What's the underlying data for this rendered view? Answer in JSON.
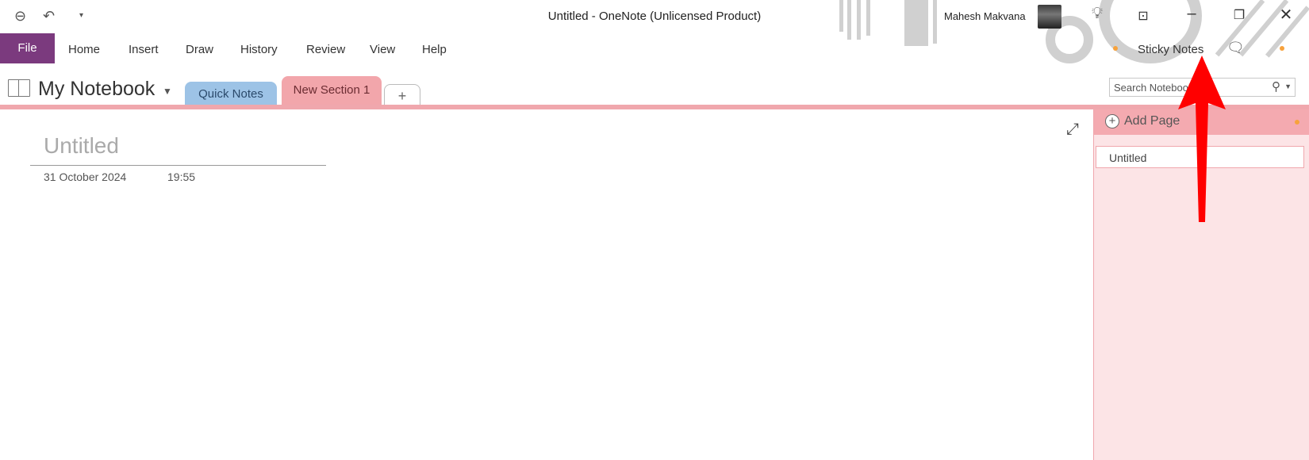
{
  "window": {
    "title": "Untitled  -  OneNote (Unlicensed Product)",
    "user": "Mahesh Makvana"
  },
  "quick_access": {
    "back_icon": "back-circle-icon",
    "undo_icon": "undo-icon",
    "customize_icon": "dropdown-icon"
  },
  "ribbon": {
    "tabs": [
      "File",
      "Home",
      "Insert",
      "Draw",
      "History",
      "Review",
      "View",
      "Help"
    ],
    "sticky_notes": "Sticky Notes"
  },
  "notebook": {
    "name": "My Notebook",
    "sections": [
      {
        "label": "Quick Notes",
        "color": "#9dc3e6"
      },
      {
        "label": "New Section 1",
        "color": "#f2a6ab"
      }
    ],
    "add_section": "+"
  },
  "search": {
    "placeholder": "Search Notebooks"
  },
  "pages_pane": {
    "add_page": "Add Page",
    "pages": [
      "Untitled"
    ]
  },
  "page": {
    "title_placeholder": "Untitled",
    "date": "31 October 2024",
    "time": "19:55"
  },
  "colors": {
    "file_tab": "#7b3a7e",
    "section_accent": "#f0a7ad",
    "pane_bg": "#fce4e6",
    "annotation_arrow": "#ff0000"
  }
}
